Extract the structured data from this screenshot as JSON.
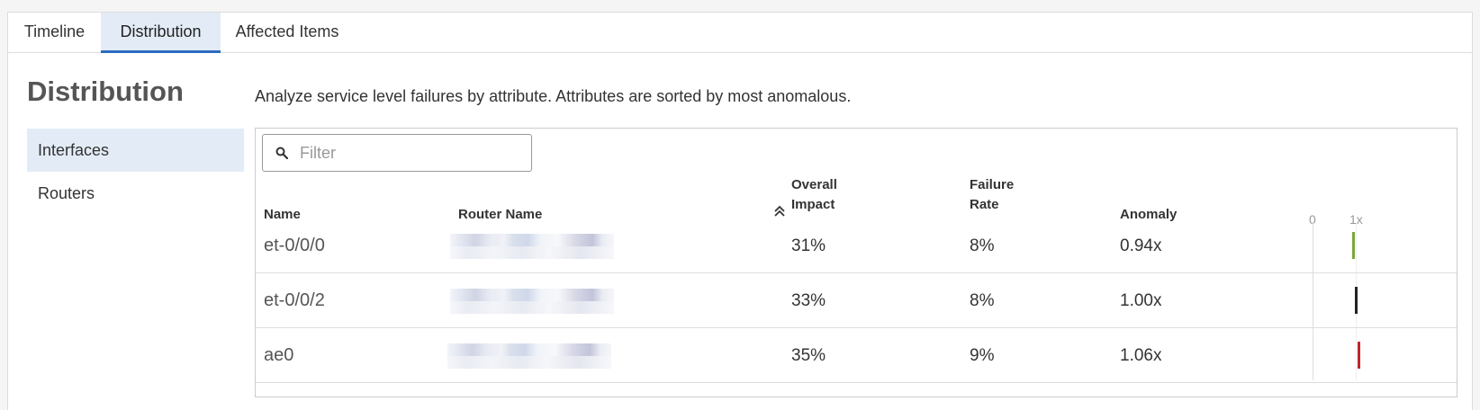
{
  "tabs": [
    "Timeline",
    "Distribution",
    "Affected Items"
  ],
  "sidebar": {
    "title": "Distribution",
    "items": [
      "Interfaces",
      "Routers"
    ]
  },
  "description": "Analyze service level failures by attribute. Attributes are sorted by most anomalous.",
  "filter": {
    "placeholder": "Filter",
    "value": ""
  },
  "table": {
    "headers": {
      "name": "Name",
      "router": "Router Name",
      "impact_line1": "Overall",
      "impact_line2": "Impact",
      "failure_line1": "Failure",
      "failure_line2": "Rate",
      "anomaly": "Anomaly",
      "scale_min": "0",
      "scale_max": "1x"
    },
    "rows": [
      {
        "name": "et-0/0/0",
        "impact": "31%",
        "failure": "8%",
        "anomaly": "0.94x",
        "anomaly_value": 0.94,
        "color": "#7aa83c"
      },
      {
        "name": "et-0/0/2",
        "impact": "33%",
        "failure": "8%",
        "anomaly": "1.00x",
        "anomaly_value": 1.0,
        "color": "#222222"
      },
      {
        "name": "ae0",
        "impact": "35%",
        "failure": "9%",
        "anomaly": "1.06x",
        "anomaly_value": 1.06,
        "color": "#c0262c"
      }
    ]
  },
  "icons": {
    "search": "search-icon",
    "sort": "sort-ascending-icon"
  },
  "colors": {
    "accent": "#2c6cbf",
    "active_bg": "#e3ecf6"
  }
}
